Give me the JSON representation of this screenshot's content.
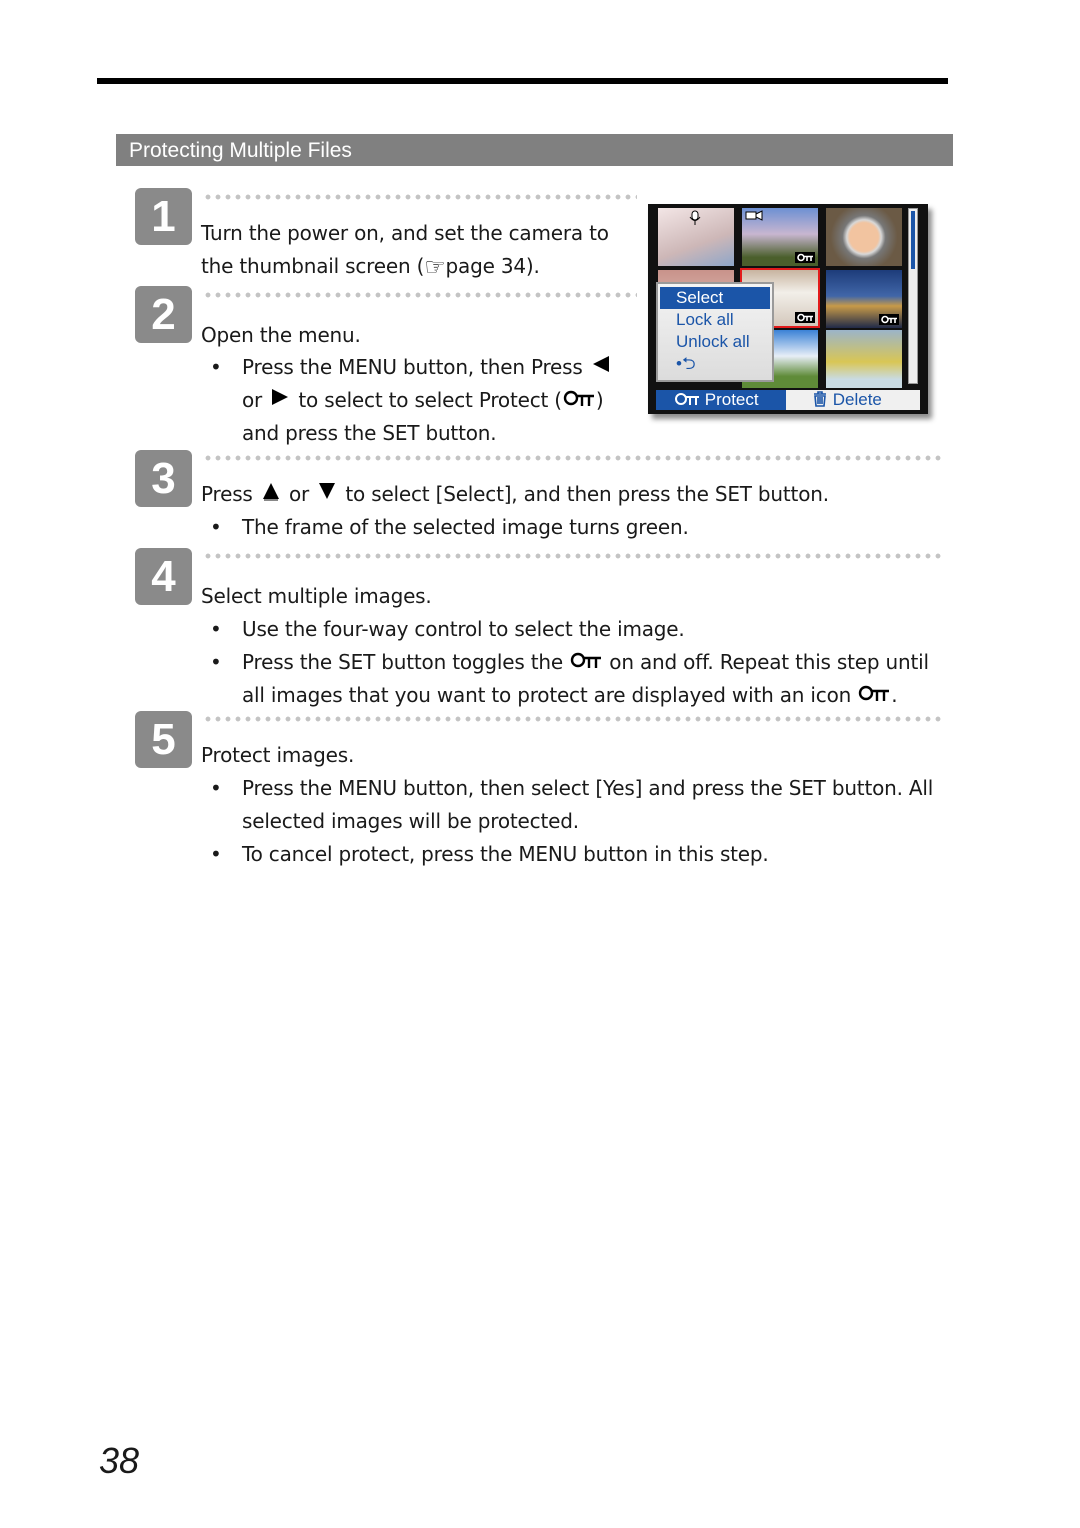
{
  "section": {
    "title": "Protecting Multiple Files"
  },
  "steps": [
    {
      "number": "1",
      "lines": [
        "Turn the power on, and set the camera to",
        "the thumbnail screen (",
        "page 34)."
      ]
    },
    {
      "number": "2",
      "heading": "Open the menu.",
      "bullet": {
        "part1": "Press the MENU button, then Press",
        "part2": "or",
        "part3": "to select to select Protect (",
        "part4": ")",
        "part5": "and press the SET button."
      }
    },
    {
      "number": "3",
      "heading": {
        "part1": "Press",
        "part2": "or",
        "part3": "to select [Select], and then press the SET button."
      },
      "bullets": [
        "The frame of the selected image turns green."
      ]
    },
    {
      "number": "4",
      "heading": "Select multiple images.",
      "bullets": [
        "Use the four-way control to select the image.",
        {
          "part1": "Press the SET button toggles the",
          "part2": "on and off. Repeat this step until"
        },
        {
          "part1": "all images that you want to protect are displayed with an icon",
          "part2": "."
        }
      ]
    },
    {
      "number": "5",
      "heading": "Protect images.",
      "bullets": [
        "Press the MENU button, then select [Yes] and press the SET button. All",
        "selected images will be protected.",
        "To cancel protect, press the MENU button in this step."
      ]
    }
  ],
  "camera_screen": {
    "menu_items": [
      "Select",
      "Lock all",
      "Unlock all",
      "•⮌"
    ],
    "selected_menu_item": "Select",
    "bottom_bar": {
      "protect_label": "Protect",
      "delete_label": "Delete"
    },
    "icons": [
      "voice-memo-icon",
      "movie-icon",
      "lock-icon",
      "trash-icon",
      "return-icon"
    ]
  },
  "bullet_char": "•",
  "page_number": "38"
}
